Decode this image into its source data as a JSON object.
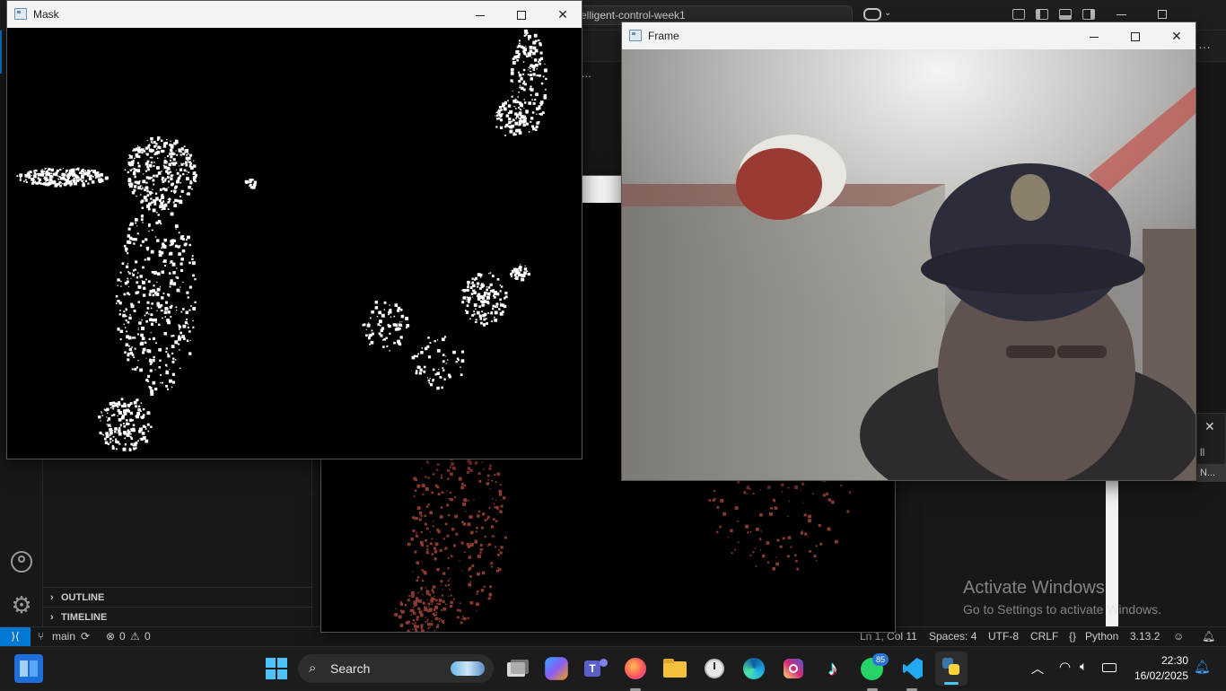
{
  "vscode": {
    "title_search_text": "elligent-control-week1",
    "tab_overflow": "...",
    "sections": {
      "outline": "OUTLINE",
      "timeline": "TIMELINE"
    },
    "notification": {
      "close_glyph": "✕",
      "text1": "ll",
      "text2": "N..."
    },
    "status": {
      "branch": "main",
      "errors": "0",
      "warnings": "0",
      "position": "Ln 1, Col 11",
      "spaces": "Spaces: 4",
      "encoding": "UTF-8",
      "eol": "CRLF",
      "language": "Python",
      "version": "3.13.2"
    },
    "icons": [
      "copilot-icon",
      "account-icon",
      "manage-gear-icon",
      "branch-icon",
      "sync-icon",
      "error-icon",
      "warning-icon",
      "remote-icon",
      "bell-icon"
    ]
  },
  "windows": {
    "mask": {
      "title": "Mask"
    },
    "frame": {
      "title": "Frame"
    },
    "result": {
      "title": ""
    }
  },
  "watermark": {
    "line1": "Activate Windows",
    "line2": "Go to Settings to activate Windows."
  },
  "taskbar": {
    "search_label": "Search",
    "whatsapp_badge": "85",
    "time": "22:30",
    "date": "16/02/2025",
    "apps": [
      "start",
      "task-view",
      "copilot",
      "teams",
      "firefox",
      "file-explorer",
      "clock",
      "edge",
      "instagram",
      "tiktok",
      "whatsapp",
      "vscode",
      "python"
    ]
  },
  "colors": {
    "accent": "#0078d4",
    "mask_white": "#ffffff",
    "result_blob": "#8a3a30"
  }
}
